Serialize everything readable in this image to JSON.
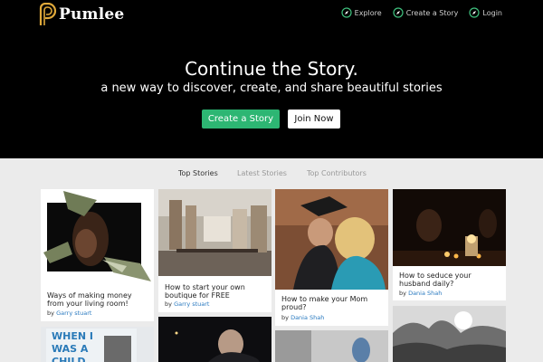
{
  "brand": {
    "name": "Pumlee"
  },
  "nav": {
    "explore": "Explore",
    "create": "Create a Story",
    "login": "Login"
  },
  "hero": {
    "title": "Continue the Story.",
    "subtitle": "a new way to discover, create, and share beautiful stories",
    "create_button": "Create a Story",
    "join_button": "Join Now"
  },
  "tabs": [
    {
      "label": "Top Stories",
      "active": true
    },
    {
      "label": "Latest Stories",
      "active": false
    },
    {
      "label": "Top Contributors",
      "active": false
    }
  ],
  "stories": [
    {
      "title": "Ways of making money from your living room!",
      "by": "by",
      "author": "Garry stuart"
    },
    {
      "title": "How to start your own boutique for FREE",
      "by": "by",
      "author": "Garry stuart"
    },
    {
      "title": "How to make your Mom proud?",
      "by": "by",
      "author": "Dania Shah"
    },
    {
      "title": "How to seduce your husband daily?",
      "by": "by",
      "author": "Dania Shah"
    }
  ],
  "second_row": {
    "sign_text": "WHEN I WAS A CHILD"
  },
  "colors": {
    "hero_bg": "#000000",
    "accent_green": "#2db673",
    "logo_gold": "#e0a93a",
    "link_blue": "#2a7ac0",
    "page_bg": "#ebebeb"
  },
  "icons": {
    "nav": "compass-icon",
    "logo": "pumlee-p-logo"
  }
}
